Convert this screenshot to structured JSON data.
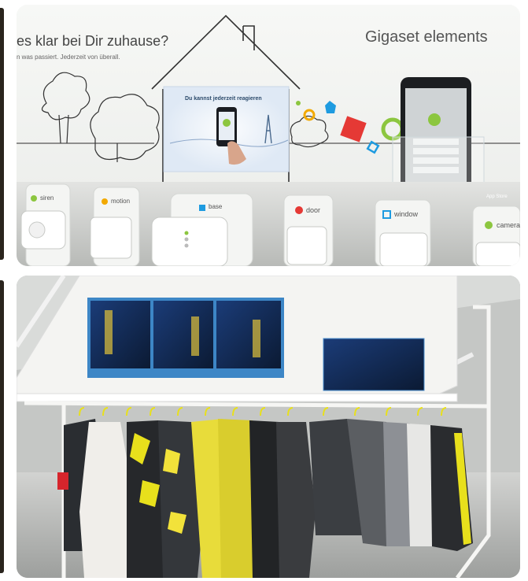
{
  "top_photo": {
    "headline": "es klar bei Dir zuhause?",
    "subline": "n was passiert. Jederzeit von überall.",
    "brand_logo": "Gigaset elements",
    "screen_caption": "Du kannst jederzeit reagieren",
    "sensors": [
      {
        "label": "siren",
        "color": "#8cc63f"
      },
      {
        "label": "motion",
        "color": "#f2a900"
      },
      {
        "label": "base",
        "color": "#1e9be0"
      },
      {
        "label": "door",
        "color": "#e53935"
      },
      {
        "label": "window",
        "color": "#1e9be0"
      },
      {
        "label": "camera",
        "color": "#8cc63f"
      }
    ],
    "app_store_badge": "App Store"
  },
  "bottom_photo": {
    "accent_color": "#e8e01c",
    "display_count": 4
  }
}
